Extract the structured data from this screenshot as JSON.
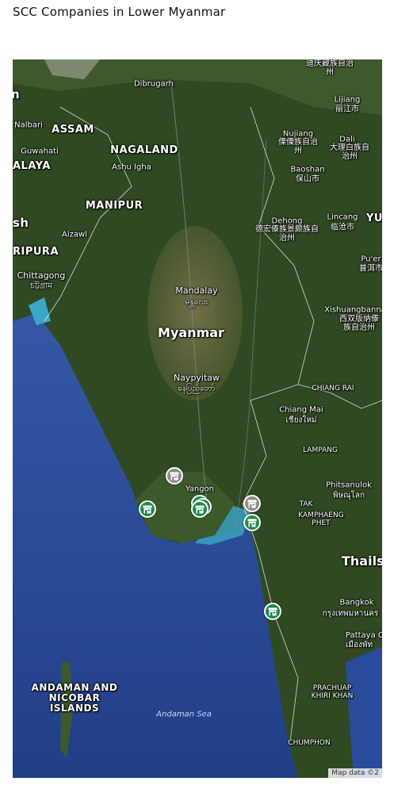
{
  "title": "SCC Companies in Lower Myanmar",
  "attribution": "Map data ©2",
  "colors": {
    "marker_green": "#1f8a4c",
    "marker_gray": "#8c8c8c",
    "sea": "#2a4f9a",
    "land": "#2f4a22"
  },
  "labels": {
    "assam": "ASSAM",
    "nagaland": "NAGALAND",
    "manipur": "MANIPUR",
    "alaya": "ALAYA",
    "ripura": "RIPURA",
    "sh": "sh",
    "n_edge": "n",
    "myanmar": "Myanmar",
    "thailand": "Thails",
    "dibrugarh": "Dibrugarh",
    "nalbari": "Nalbari",
    "guwahati": "Guwahati",
    "ashu_igha": "Ashu Igha",
    "aizawl": "Aizawl",
    "chittagong": "Chittagong",
    "chittagong_local": "চট্টগ্রাম",
    "mandalay": "Mandalay",
    "mandalay_local": "မန္တလေး",
    "naypyitaw": "Naypyitaw",
    "naypyitaw_local": "နေပြည်တော်",
    "yangon": "Yangon",
    "nujiang": "Nujiang",
    "nujiang_local": "傈僳族自治州",
    "lijiang": "Lijiang",
    "lijiang_local": "丽江市",
    "dali": "Dali",
    "dali_local": "大理白族自治州",
    "baoshan": "Baoshan",
    "baoshan_local": "保山市",
    "dehong": "Dehong",
    "dehong_local": "德宏傣族景颇族自治州",
    "lincang": "Lincang",
    "lincang_local": "临沧市",
    "yu": "YU",
    "puer": "Pu'er",
    "puer_local": "普洱市",
    "xishuangbanna": "Xishuangbanna",
    "xishuangbanna_local": "西双版纳傣族自治州",
    "chiang_rai": "CHIANG RAI",
    "chiang_mai": "Chiang Mai",
    "chiang_mai_local": "เชียงใหม่",
    "lampang": "LAMPANG",
    "phitsanulok": "Phitsanulok",
    "phitsanulok_local": "พิษณุโลก",
    "tak": "TAK",
    "kamphaeng_phet": "KAMPHAENG PHET",
    "bangkok": "Bangkok",
    "bangkok_local": "กรุงเทพมหานคร",
    "pattaya": "Pattaya C",
    "pattaya_local": "เมืองพัท",
    "prachuap": "PRACHUAP KHIRI KHAN",
    "chumphon": "CHUMPHON",
    "andaman_nicobar": "ANDAMAN AND NICOBAR ISLANDS",
    "andaman_sea": "Andaman Sea",
    "top_right": "迪庆藏族自治州"
  },
  "markers": [
    {
      "name": "marker-yangon-north",
      "status": "gray",
      "icon": "store-icon"
    },
    {
      "name": "marker-pathein",
      "status": "green",
      "icon": "store-icon"
    },
    {
      "name": "marker-yangon-1",
      "status": "green",
      "icon": "store-icon"
    },
    {
      "name": "marker-yangon-2",
      "status": "green",
      "icon": "store-icon"
    },
    {
      "name": "marker-yangon-3",
      "status": "green",
      "icon": "store-icon"
    },
    {
      "name": "marker-mawlamyine-gray",
      "status": "gray",
      "icon": "store-icon"
    },
    {
      "name": "marker-mawlamyine-green",
      "status": "green",
      "icon": "store-icon"
    },
    {
      "name": "marker-dawei",
      "status": "green",
      "icon": "store-icon"
    }
  ]
}
